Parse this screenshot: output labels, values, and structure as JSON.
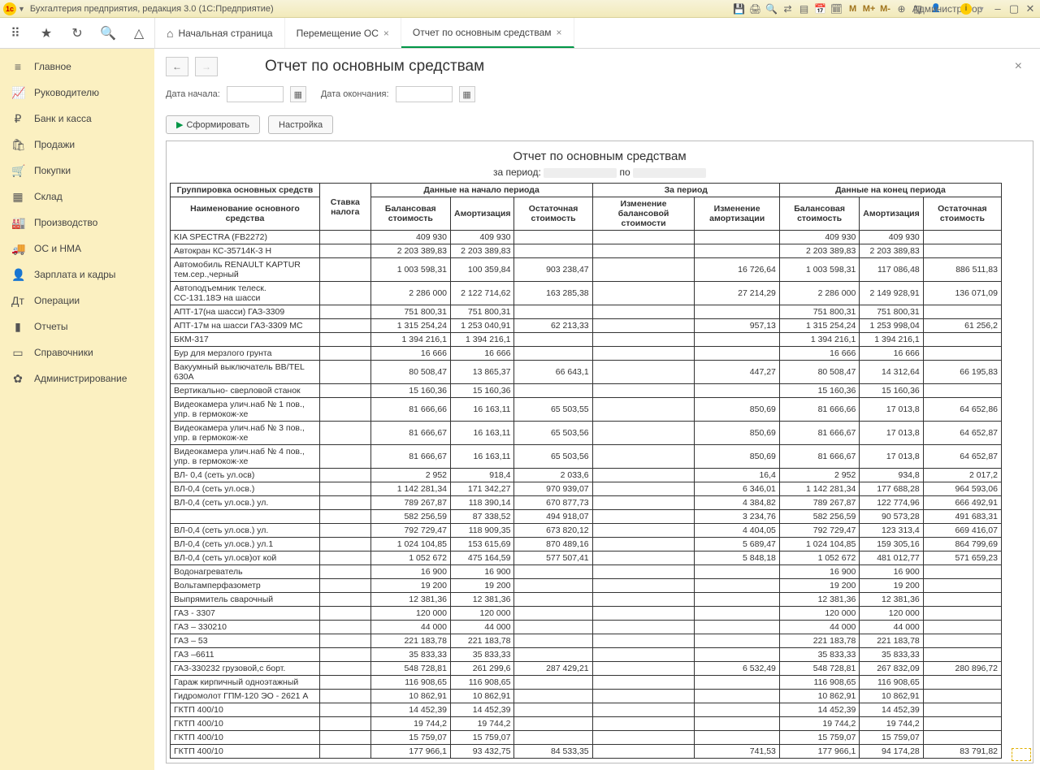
{
  "titlebar": {
    "title": "Бухгалтерия предприятия, редакция 3.0  (1С:Предприятие)",
    "user": "Администратор"
  },
  "tabs": {
    "home": "Начальная страница",
    "t1": "Перемещение ОС",
    "t2": "Отчет по основным средствам"
  },
  "sidebar": [
    {
      "icon": "≡",
      "label": "Главное"
    },
    {
      "icon": "📈",
      "label": "Руководителю"
    },
    {
      "icon": "₽",
      "label": "Банк и касса"
    },
    {
      "icon": "🛍",
      "label": "Продажи"
    },
    {
      "icon": "🛒",
      "label": "Покупки"
    },
    {
      "icon": "▦",
      "label": "Склад"
    },
    {
      "icon": "🏭",
      "label": "Производство"
    },
    {
      "icon": "🚚",
      "label": "ОС и НМА"
    },
    {
      "icon": "👤",
      "label": "Зарплата и кадры"
    },
    {
      "icon": "Дт",
      "label": "Операции"
    },
    {
      "icon": "▮",
      "label": "Отчеты"
    },
    {
      "icon": "▭",
      "label": "Справочники"
    },
    {
      "icon": "✿",
      "label": "Администрирование"
    }
  ],
  "page": {
    "title": "Отчет по основным средствам",
    "date_start_label": "Дата начала:",
    "date_end_label": "Дата окончания:",
    "form_btn": "Сформировать",
    "settings_btn": "Настройка"
  },
  "report": {
    "title": "Отчет по основным средствам",
    "period_prefix": "за период:",
    "period_mid": "по",
    "group_header": "Группировка основных средств",
    "col_name": "Наименование основного средства",
    "col_tax": "Ставка налога",
    "h_begin": "Данные на начало периода",
    "h_period": "За период",
    "h_end": "Данные на конец периода",
    "c_bal": "Балансовая стоимость",
    "c_amort": "Амортизация",
    "c_rest": "Остаточная стоимость",
    "c_dbal": "Изменение балансовой стоимости",
    "c_damort": "Изменение амортизации"
  },
  "rows": [
    {
      "n": "KIA SPECTRA (FB2272)",
      "b": "409 930",
      "a": "409 930",
      "r": "",
      "db": "",
      "da": "",
      "eb": "409 930",
      "ea": "409 930",
      "er": ""
    },
    {
      "n": "Автокран КС-35714К-3  Н",
      "b": "2 203 389,83",
      "a": "2 203 389,83",
      "r": "",
      "db": "",
      "da": "",
      "eb": "2 203 389,83",
      "ea": "2 203 389,83",
      "er": ""
    },
    {
      "n": "Автомобиль RENAULT KAPTUR тем.сер.,черный",
      "b": "1 003 598,31",
      "a": "100 359,84",
      "r": "903 238,47",
      "db": "",
      "da": "16 726,64",
      "eb": "1 003 598,31",
      "ea": "117 086,48",
      "er": "886 511,83"
    },
    {
      "n": "Автоподъемник телеск. СС-131.18Э на шасси",
      "b": "2 286 000",
      "a": "2 122 714,62",
      "r": "163 285,38",
      "db": "",
      "da": "27 214,29",
      "eb": "2 286 000",
      "ea": "2 149 928,91",
      "er": "136 071,09"
    },
    {
      "n": "АПТ-17(на шасси) ГАЗ-3309",
      "b": "751 800,31",
      "a": "751 800,31",
      "r": "",
      "db": "",
      "da": "",
      "eb": "751 800,31",
      "ea": "751 800,31",
      "er": ""
    },
    {
      "n": "АПТ-17м на шасси ГАЗ-3309       МС",
      "b": "1 315 254,24",
      "a": "1 253 040,91",
      "r": "62 213,33",
      "db": "",
      "da": "957,13",
      "eb": "1 315 254,24",
      "ea": "1 253 998,04",
      "er": "61 256,2"
    },
    {
      "n": "БКМ-317",
      "b": "1 394 216,1",
      "a": "1 394 216,1",
      "r": "",
      "db": "",
      "da": "",
      "eb": "1 394 216,1",
      "ea": "1 394 216,1",
      "er": ""
    },
    {
      "n": "Бур для мерзлого грунта",
      "b": "16 666",
      "a": "16 666",
      "r": "",
      "db": "",
      "da": "",
      "eb": "16 666",
      "ea": "16 666",
      "er": ""
    },
    {
      "n": "Вакуумный выключатель BB/TEL 630А",
      "b": "80 508,47",
      "a": "13 865,37",
      "r": "66 643,1",
      "db": "",
      "da": "447,27",
      "eb": "80 508,47",
      "ea": "14 312,64",
      "er": "66 195,83"
    },
    {
      "n": "Вертикально- сверловой станок",
      "b": "15 160,36",
      "a": "15 160,36",
      "r": "",
      "db": "",
      "da": "",
      "eb": "15 160,36",
      "ea": "15 160,36",
      "er": ""
    },
    {
      "n": "Видеокамера улич.наб № 1 пов., упр. в гермокож-хе",
      "b": "81 666,66",
      "a": "16 163,11",
      "r": "65 503,55",
      "db": "",
      "da": "850,69",
      "eb": "81 666,66",
      "ea": "17 013,8",
      "er": "64 652,86"
    },
    {
      "n": "Видеокамера улич.наб № 3 пов., упр. в гермокож-хе",
      "b": "81 666,67",
      "a": "16 163,11",
      "r": "65 503,56",
      "db": "",
      "da": "850,69",
      "eb": "81 666,67",
      "ea": "17 013,8",
      "er": "64 652,87"
    },
    {
      "n": "Видеокамера улич.наб № 4 пов., упр. в гермокож-хе",
      "b": "81 666,67",
      "a": "16 163,11",
      "r": "65 503,56",
      "db": "",
      "da": "850,69",
      "eb": "81 666,67",
      "ea": "17 013,8",
      "er": "64 652,87"
    },
    {
      "n": "ВЛ- 0,4 (сеть ул.осв)",
      "b": "2 952",
      "a": "918,4",
      "r": "2 033,6",
      "db": "",
      "da": "16,4",
      "eb": "2 952",
      "ea": "934,8",
      "er": "2 017,2"
    },
    {
      "n": "ВЛ-0,4 (сеть ул.осв.)",
      "b": "1 142 281,34",
      "a": "171 342,27",
      "r": "970 939,07",
      "db": "",
      "da": "6 346,01",
      "eb": "1 142 281,34",
      "ea": "177 688,28",
      "er": "964 593,06"
    },
    {
      "n": "ВЛ-0,4 (сеть ул.осв.) ул.",
      "b": "789 267,87",
      "a": "118 390,14",
      "r": "670 877,73",
      "db": "",
      "da": "4 384,82",
      "eb": "789 267,87",
      "ea": "122 774,96",
      "er": "666 492,91"
    },
    {
      "n": "",
      "b": "582 256,59",
      "a": "87 338,52",
      "r": "494 918,07",
      "db": "",
      "da": "3 234,76",
      "eb": "582 256,59",
      "ea": "90 573,28",
      "er": "491 683,31"
    },
    {
      "n": "ВЛ-0,4 (сеть ул.осв.) ул.",
      "b": "792 729,47",
      "a": "118 909,35",
      "r": "673 820,12",
      "db": "",
      "da": "4 404,05",
      "eb": "792 729,47",
      "ea": "123 313,4",
      "er": "669 416,07"
    },
    {
      "n": "ВЛ-0,4 (сеть ул.осв.) ул.1",
      "b": "1 024 104,85",
      "a": "153 615,69",
      "r": "870 489,16",
      "db": "",
      "da": "5 689,47",
      "eb": "1 024 104,85",
      "ea": "159 305,16",
      "er": "864 799,69"
    },
    {
      "n": "ВЛ-0,4 (сеть ул.осв)от           кой",
      "b": "1 052 672",
      "a": "475 164,59",
      "r": "577 507,41",
      "db": "",
      "da": "5 848,18",
      "eb": "1 052 672",
      "ea": "481 012,77",
      "er": "571 659,23"
    },
    {
      "n": "Водонагреватель",
      "b": "16 900",
      "a": "16 900",
      "r": "",
      "db": "",
      "da": "",
      "eb": "16 900",
      "ea": "16 900",
      "er": ""
    },
    {
      "n": "Вольтамперфазометр",
      "b": "19 200",
      "a": "19 200",
      "r": "",
      "db": "",
      "da": "",
      "eb": "19 200",
      "ea": "19 200",
      "er": ""
    },
    {
      "n": "Выпрямитель сварочный",
      "b": "12 381,36",
      "a": "12 381,36",
      "r": "",
      "db": "",
      "da": "",
      "eb": "12 381,36",
      "ea": "12 381,36",
      "er": ""
    },
    {
      "n": "ГАЗ - 3307",
      "b": "120 000",
      "a": "120 000",
      "r": "",
      "db": "",
      "da": "",
      "eb": "120 000",
      "ea": "120 000",
      "er": ""
    },
    {
      "n": "ГАЗ – 330210",
      "b": "44 000",
      "a": "44 000",
      "r": "",
      "db": "",
      "da": "",
      "eb": "44 000",
      "ea": "44 000",
      "er": ""
    },
    {
      "n": "ГАЗ – 53",
      "b": "221 183,78",
      "a": "221 183,78",
      "r": "",
      "db": "",
      "da": "",
      "eb": "221 183,78",
      "ea": "221 183,78",
      "er": ""
    },
    {
      "n": "ГАЗ –6611",
      "b": "35 833,33",
      "a": "35 833,33",
      "r": "",
      "db": "",
      "da": "",
      "eb": "35 833,33",
      "ea": "35 833,33",
      "er": ""
    },
    {
      "n": "ГАЗ-330232  грузовой,с борт.",
      "b": "548 728,81",
      "a": "261 299,6",
      "r": "287 429,21",
      "db": "",
      "da": "6 532,49",
      "eb": "548 728,81",
      "ea": "267 832,09",
      "er": "280 896,72"
    },
    {
      "n": "Гараж кирпичный одноэтажный",
      "b": "116 908,65",
      "a": "116 908,65",
      "r": "",
      "db": "",
      "da": "",
      "eb": "116 908,65",
      "ea": "116 908,65",
      "er": ""
    },
    {
      "n": "Гидромолот ГПМ-120         ЭО - 2621 А",
      "b": "10 862,91",
      "a": "10 862,91",
      "r": "",
      "db": "",
      "da": "",
      "eb": "10 862,91",
      "ea": "10 862,91",
      "er": ""
    },
    {
      "n": "ГКТП 400/10",
      "b": "14 452,39",
      "a": "14 452,39",
      "r": "",
      "db": "",
      "da": "",
      "eb": "14 452,39",
      "ea": "14 452,39",
      "er": ""
    },
    {
      "n": "ГКТП 400/10",
      "b": "19 744,2",
      "a": "19 744,2",
      "r": "",
      "db": "",
      "da": "",
      "eb": "19 744,2",
      "ea": "19 744,2",
      "er": ""
    },
    {
      "n": "ГКТП 400/10",
      "b": "15 759,07",
      "a": "15 759,07",
      "r": "",
      "db": "",
      "da": "",
      "eb": "15 759,07",
      "ea": "15 759,07",
      "er": ""
    },
    {
      "n": "ГКТП 400/10",
      "b": "177 966,1",
      "a": "93 432,75",
      "r": "84 533,35",
      "db": "",
      "da": "741,53",
      "eb": "177 966,1",
      "ea": "94 174,28",
      "er": "83 791,82"
    }
  ]
}
